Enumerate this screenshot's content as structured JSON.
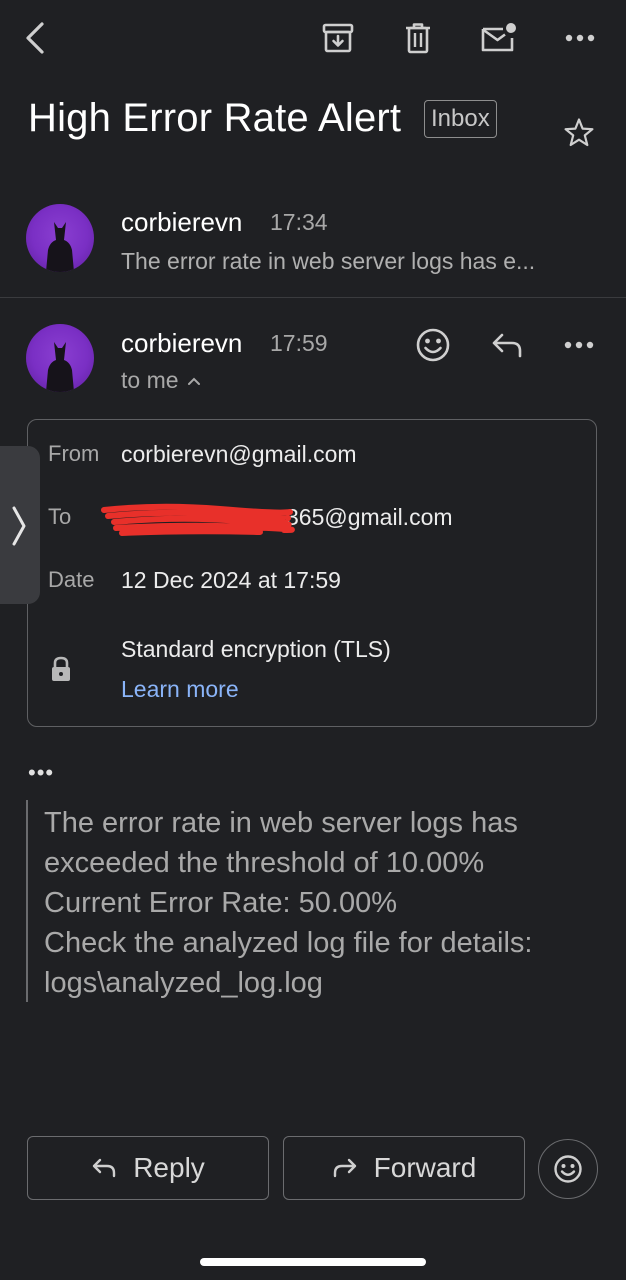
{
  "subject": "High Error Rate Alert",
  "label": "Inbox",
  "icons": {
    "back": "chevron-left-icon",
    "archive": "archive-icon",
    "delete": "trash-icon",
    "mark_unread": "mail-unread-icon",
    "more": "more-horizontal-icon",
    "star": "star-icon",
    "emoji": "emoji-icon",
    "reply": "reply-icon",
    "lock": "lock-icon"
  },
  "thread": {
    "collapsed_message": {
      "sender": "corbierevn",
      "time": "17:34",
      "snippet": "The error rate in web server logs has e..."
    },
    "expanded_message": {
      "sender": "corbierevn",
      "time": "17:59",
      "recipient_summary": "to me",
      "details": {
        "from_label": "From",
        "from_value": "corbierevn@gmail.com",
        "to_label": "To",
        "to_value_visible": "365@gmail.com",
        "date_label": "Date",
        "date_value": "12 Dec 2024 at 17:59",
        "encryption": "Standard encryption (TLS)",
        "learn_more": "Learn more"
      },
      "show_trimmed": "•••",
      "body_lines": [
        "The error rate in web server logs has",
        "exceeded the threshold of 10.00%",
        "Current Error Rate: 50.00%",
        "Check the analyzed log file for details:",
        "logs\\analyzed_log.log"
      ]
    }
  },
  "actions": {
    "reply": "Reply",
    "forward": "Forward"
  },
  "colors": {
    "background": "#1f2023",
    "link": "#8ab4f8",
    "avatar": "#7a2fc4",
    "redaction": "#e8302a"
  }
}
